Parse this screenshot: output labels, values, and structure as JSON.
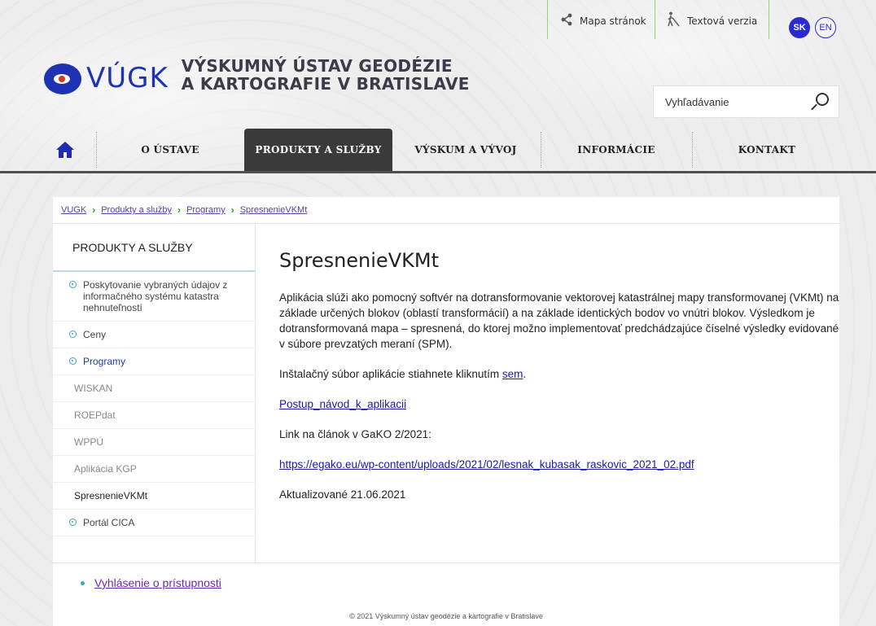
{
  "utility": {
    "sitemap_label": "Mapa stránok",
    "text_version_label": "Textová verzia",
    "languages": [
      "SK",
      "EN"
    ]
  },
  "logo": {
    "abbr": "VÚGK",
    "name_line1": "VÝSKUMNÝ ÚSTAV GEODÉZIE",
    "name_line2": "A KARTOGRAFIE V BRATISLAVE"
  },
  "search": {
    "placeholder": "Vyhľadávanie"
  },
  "nav": {
    "items": [
      {
        "label": "O ÚSTAVE"
      },
      {
        "label": "PRODUKTY A SLUŽBY"
      },
      {
        "label": "VÝSKUM A VÝVOJ"
      },
      {
        "label": "INFORMÁCIE"
      },
      {
        "label": "KONTAKT"
      }
    ]
  },
  "breadcrumb": [
    "VUGK",
    "Produkty a služby",
    "Programy",
    "SpresnenieVKMt"
  ],
  "sidebar": {
    "title": "PRODUKTY A SLUŽBY",
    "items": [
      {
        "label": "Poskytovanie vybraných údajov z informačného systému katastra nehnuteľností"
      },
      {
        "label": "Ceny"
      },
      {
        "label": "Programy"
      },
      {
        "label": "Portál CICA"
      }
    ],
    "subitems": [
      "WISKAN",
      "ROEPdat",
      "WPPÚ",
      "Aplikácia KGP",
      "SpresnenieVKMt"
    ]
  },
  "content": {
    "title": "SpresnenieVKMt",
    "description": "Aplikácia slúži ako pomocný softvér na dotransformovanie vektorovej katastrálnej mapy transformovanej (VKMt) na základe určených blokov (oblastí transformácií) a na základe identických bodov vo vnútri blokov. Výsledkom je dotransformovaná mapa – spresnená, do ktorej možno implementovať predchádzajúce číselné výsledky evidované v súbore prevzatých meraní (SPM).",
    "install_text": "Inštalačný súbor aplikácie stiahnete kliknutím",
    "install_link": "sem",
    "install_end": ".",
    "guide_link": "Postup_návod_k_aplikacii",
    "article_text": "Link na článok v GaKO 2/2021:",
    "article_link": "https://egako.eu/wp-content/uploads/2021/02/lesnak_kubasak_raskovic_2021_02.pdf",
    "updated": "Aktualizované 21.06.2021"
  },
  "footer": {
    "accessibility_link": "Vyhlásenie o prístupnosti",
    "copyright": "© 2021 Výskumný ústav geodézie a kartografie v Bratislave"
  },
  "colors": {
    "accent_blue": "#2a2ad2",
    "nav_active": "#3a3a3a",
    "separator_green": "#9bcf7e",
    "bullet": "#3aa5c9"
  }
}
